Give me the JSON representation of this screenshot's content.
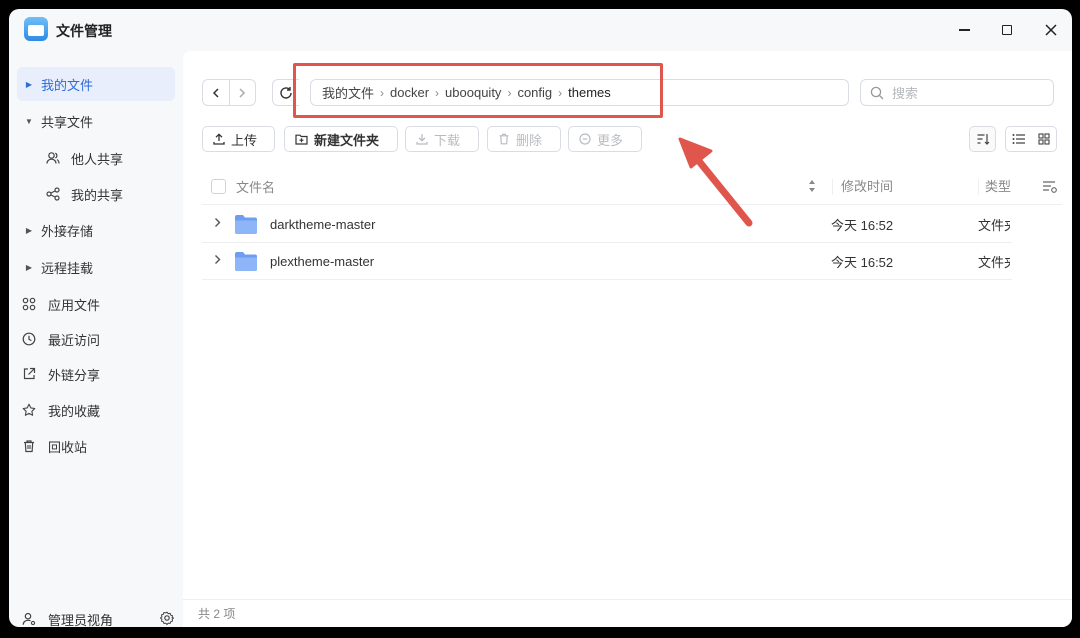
{
  "app": {
    "title": "文件管理"
  },
  "sidebar": {
    "items": [
      {
        "label": "我的文件",
        "icon": "caret-right-icon"
      },
      {
        "label": "共享文件",
        "icon": "caret-down-icon"
      },
      {
        "label": "他人共享",
        "icon": "users-icon"
      },
      {
        "label": "我的共享",
        "icon": "share-icon"
      },
      {
        "label": "外接存储",
        "icon": "caret-right-icon"
      },
      {
        "label": "远程挂载",
        "icon": "caret-right-icon"
      },
      {
        "label": "应用文件",
        "icon": "apps-icon"
      },
      {
        "label": "最近访问",
        "icon": "clock-icon"
      },
      {
        "label": "外链分享",
        "icon": "external-link-icon"
      },
      {
        "label": "我的收藏",
        "icon": "star-icon"
      },
      {
        "label": "回收站",
        "icon": "trash-icon"
      }
    ],
    "footer": {
      "label": "管理员视角"
    }
  },
  "path": {
    "crumbs": [
      "我的文件",
      "docker",
      "ubooquity",
      "config",
      "themes"
    ]
  },
  "search": {
    "placeholder": "搜索"
  },
  "toolbar": {
    "upload": "上传",
    "new_folder": "新建文件夹",
    "download": "下载",
    "delete": "删除",
    "more": "更多"
  },
  "table": {
    "headers": {
      "name": "文件名",
      "modified": "修改时间",
      "type": "类型"
    },
    "rows": [
      {
        "name": "darktheme-master",
        "modified": "今天 16:52",
        "type": "文件夹"
      },
      {
        "name": "plextheme-master",
        "modified": "今天 16:52",
        "type": "文件夹"
      }
    ]
  },
  "status": {
    "count": "共 2 项"
  },
  "colors": {
    "accent": "#2f6bd6",
    "annotation": "#e0564d",
    "folder": "#7aa9f5"
  }
}
